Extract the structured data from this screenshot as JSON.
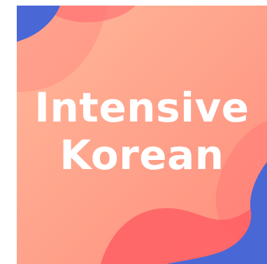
{
  "cover": {
    "title_line1": "Intensive",
    "title_line2": "Korean"
  },
  "colors": {
    "background_start": "#ffb497",
    "background_end": "#ff8a7a",
    "blob_pink": "#ff6b6f",
    "blob_red": "#ff5a5f",
    "accent_blue": "#4a67d6",
    "text": "#ffffff"
  }
}
